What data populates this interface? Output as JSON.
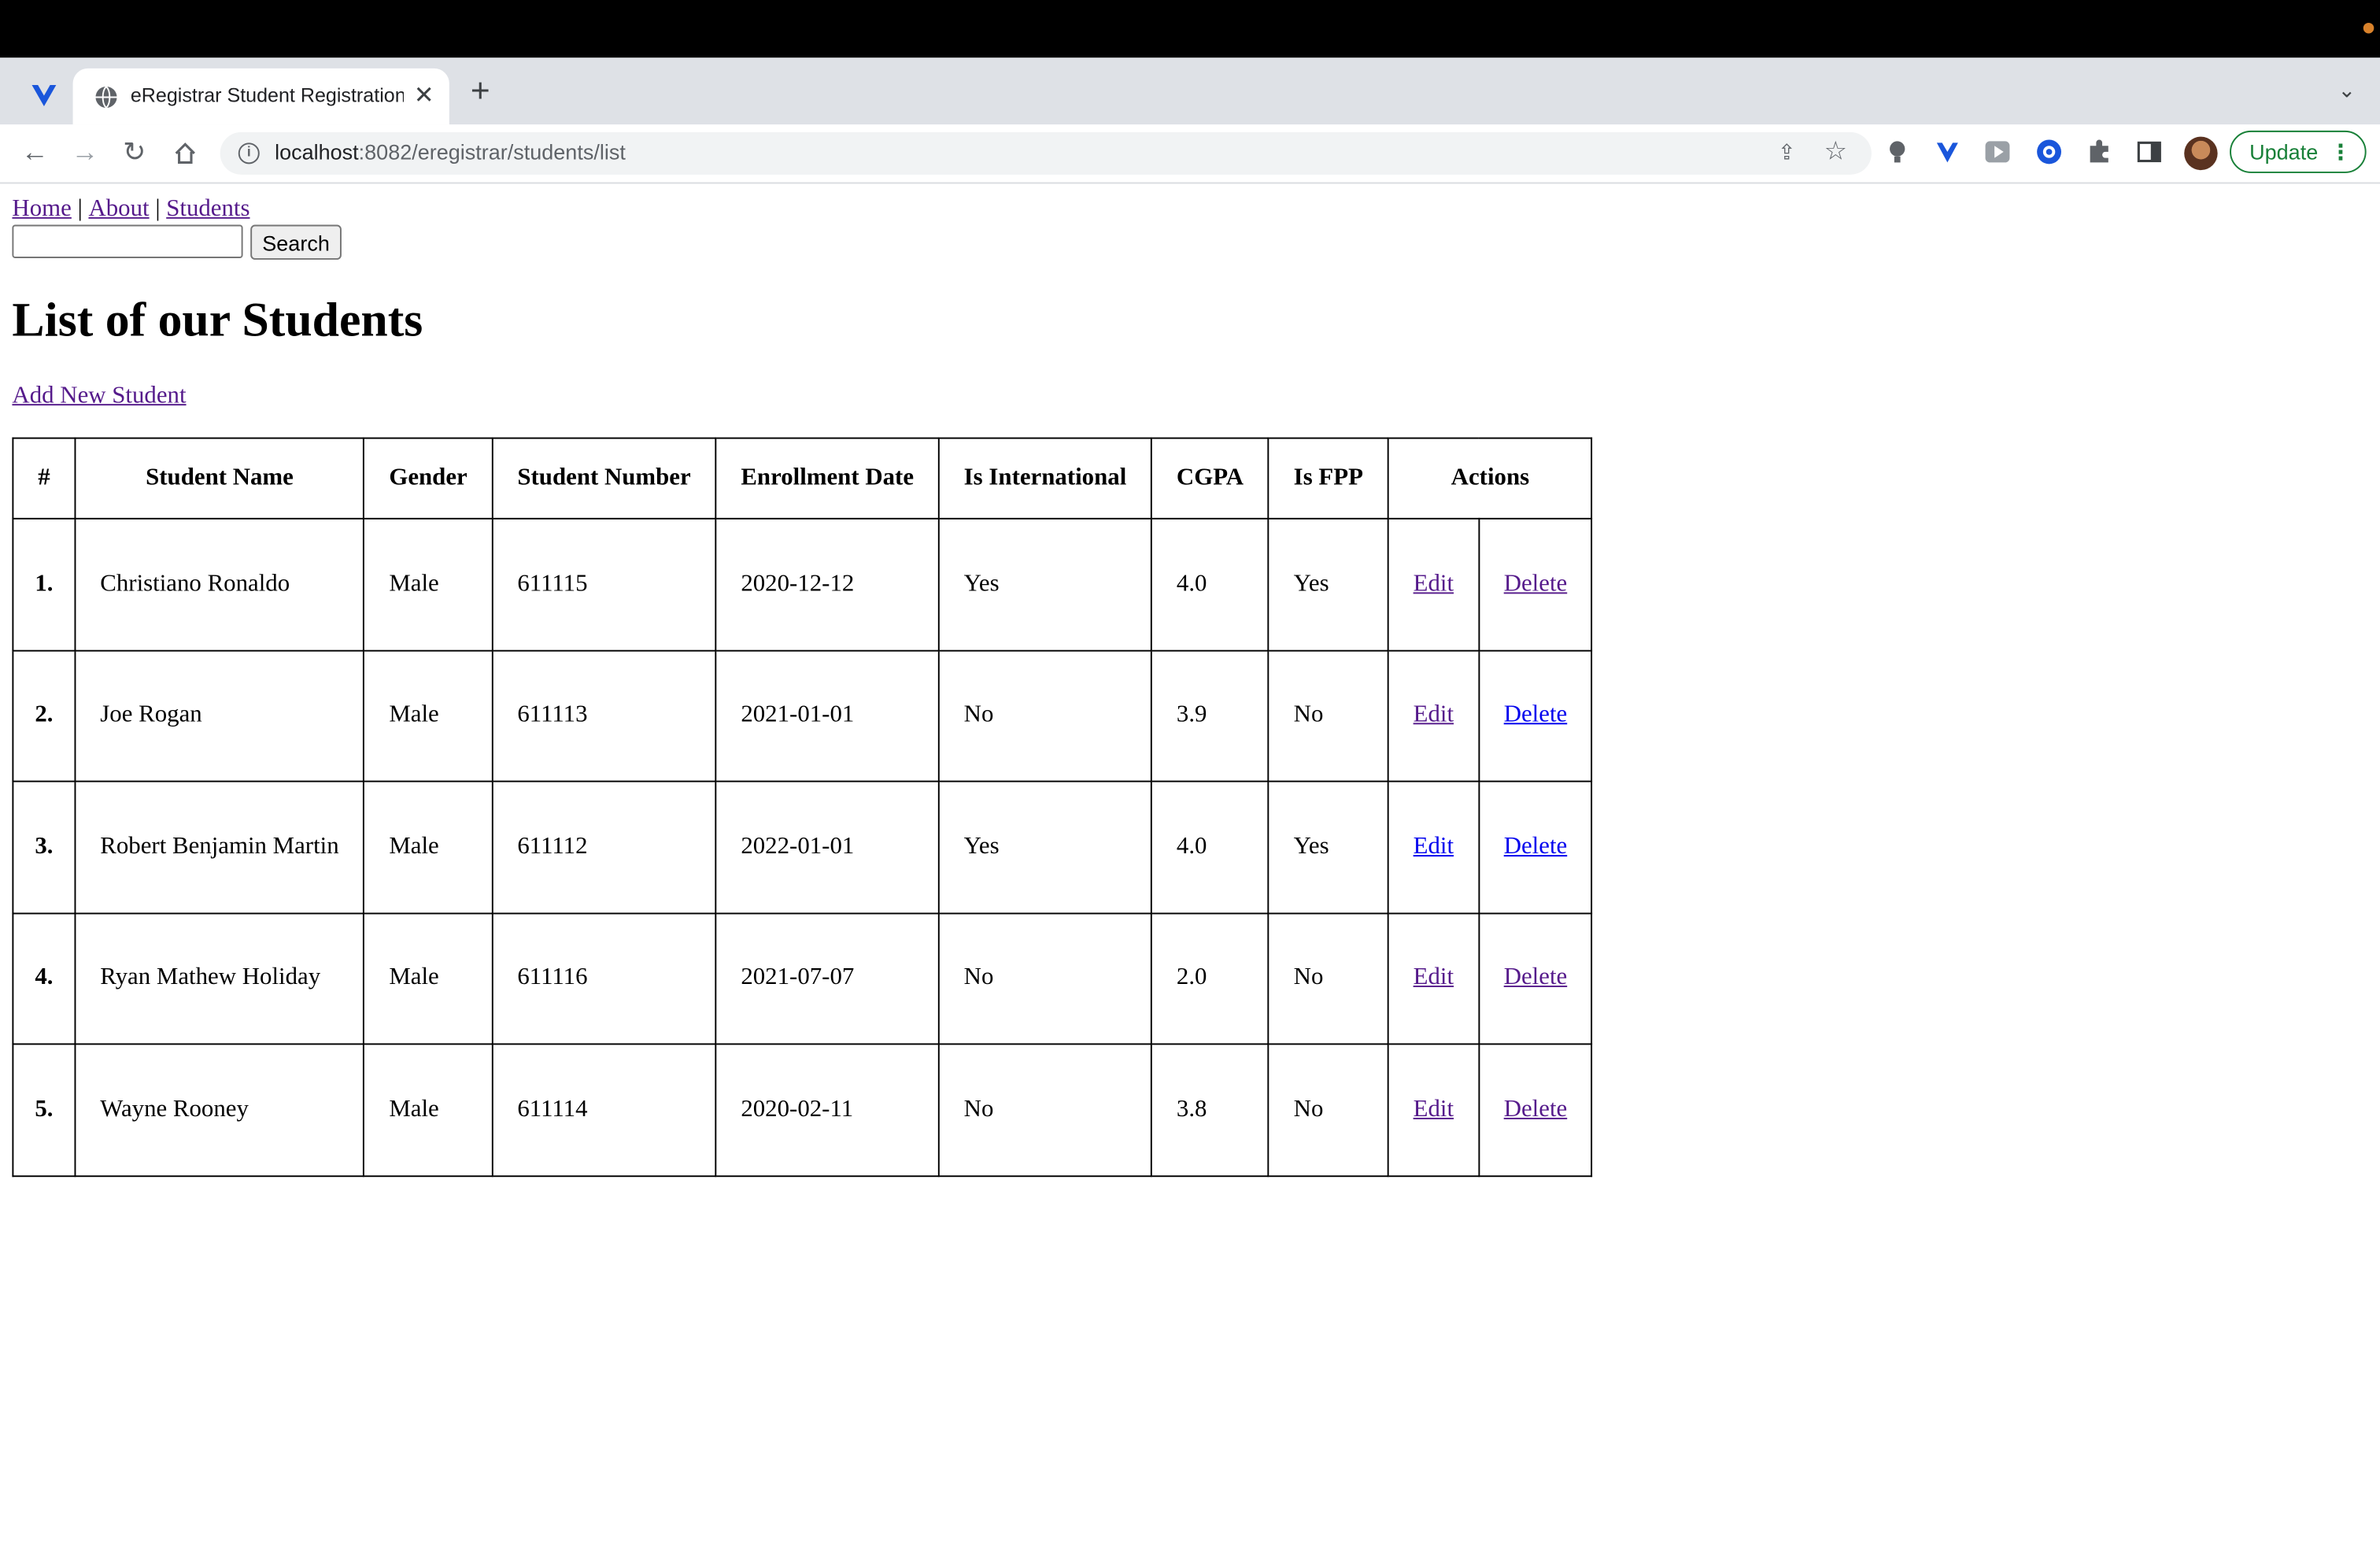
{
  "browser": {
    "tab_title": "eRegistrar Student Registration",
    "url_host": "localhost",
    "url_path": ":8082/eregistrar/students/list",
    "update_label": "Update"
  },
  "nav": {
    "home": "Home",
    "about": "About",
    "students": "Students",
    "separator": "|"
  },
  "search": {
    "value": "",
    "placeholder": "",
    "button_label": "Search"
  },
  "page_title": "List of our Students",
  "add_link": "Add New Student",
  "table": {
    "headers": [
      "#",
      "Student Name",
      "Gender",
      "Student Number",
      "Enrollment Date",
      "Is International",
      "CGPA",
      "Is FPP",
      "Actions"
    ],
    "rows": [
      {
        "num": "1.",
        "name": "Christiano Ronaldo",
        "gender": "Male",
        "number": "611115",
        "date": "2020-12-12",
        "intl": "Yes",
        "cgpa": "4.0",
        "fpp": "Yes",
        "edit": "Edit",
        "delete": "Delete"
      },
      {
        "num": "2.",
        "name": "Joe Rogan",
        "gender": "Male",
        "number": "611113",
        "date": "2021-01-01",
        "intl": "No",
        "cgpa": "3.9",
        "fpp": "No",
        "edit": "Edit",
        "delete": "Delete"
      },
      {
        "num": "3.",
        "name": "Robert Benjamin Martin",
        "gender": "Male",
        "number": "611112",
        "date": "2022-01-01",
        "intl": "Yes",
        "cgpa": "4.0",
        "fpp": "Yes",
        "edit": "Edit",
        "delete": "Delete"
      },
      {
        "num": "4.",
        "name": "Ryan Mathew Holiday",
        "gender": "Male",
        "number": "611116",
        "date": "2021-07-07",
        "intl": "No",
        "cgpa": "2.0",
        "fpp": "No",
        "edit": "Edit",
        "delete": "Delete"
      },
      {
        "num": "5.",
        "name": "Wayne Rooney",
        "gender": "Male",
        "number": "611114",
        "date": "2020-02-11",
        "intl": "No",
        "cgpa": "3.8",
        "fpp": "No",
        "edit": "Edit",
        "delete": "Delete"
      }
    ]
  },
  "colors": {
    "link_visited": "#551a8b",
    "link_unvisited": "#0000ee",
    "update_green": "#188038"
  }
}
